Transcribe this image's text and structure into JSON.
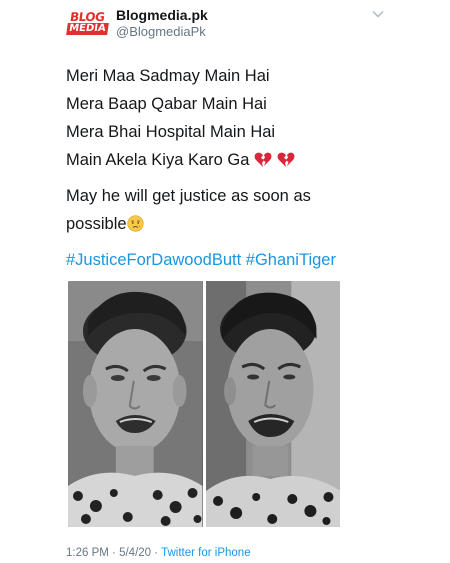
{
  "author": {
    "logo_top": "BLOG",
    "logo_bottom": "MEDIA",
    "display_name": "Blogmedia.pk",
    "handle": "@BlogmediaPk"
  },
  "tweet": {
    "lines": [
      "Meri Maa Sadmay Main Hai",
      "Mera Baap Qabar Main Hai",
      "Mera Bhai Hospital Main Hai",
      "Main Akela Kiya Karo Ga"
    ],
    "para2_line1": "May he will get justice as soon as",
    "para2_line2": "possible",
    "hashtags": [
      "#JusticeForDawoodButt",
      "#GhaniTiger"
    ],
    "emojis": {
      "broken_heart": "broken-heart-emoji",
      "crying": "crying-face-emoji"
    }
  },
  "meta": {
    "time": "1:26 PM",
    "separator": "·",
    "date": "5/4/20",
    "source": "Twitter for iPhone"
  },
  "colors": {
    "link": "#1b95e0",
    "muted": "#657786",
    "text": "#14171a",
    "brand_red": "#e0312f",
    "heart_red": "#d9263b"
  }
}
